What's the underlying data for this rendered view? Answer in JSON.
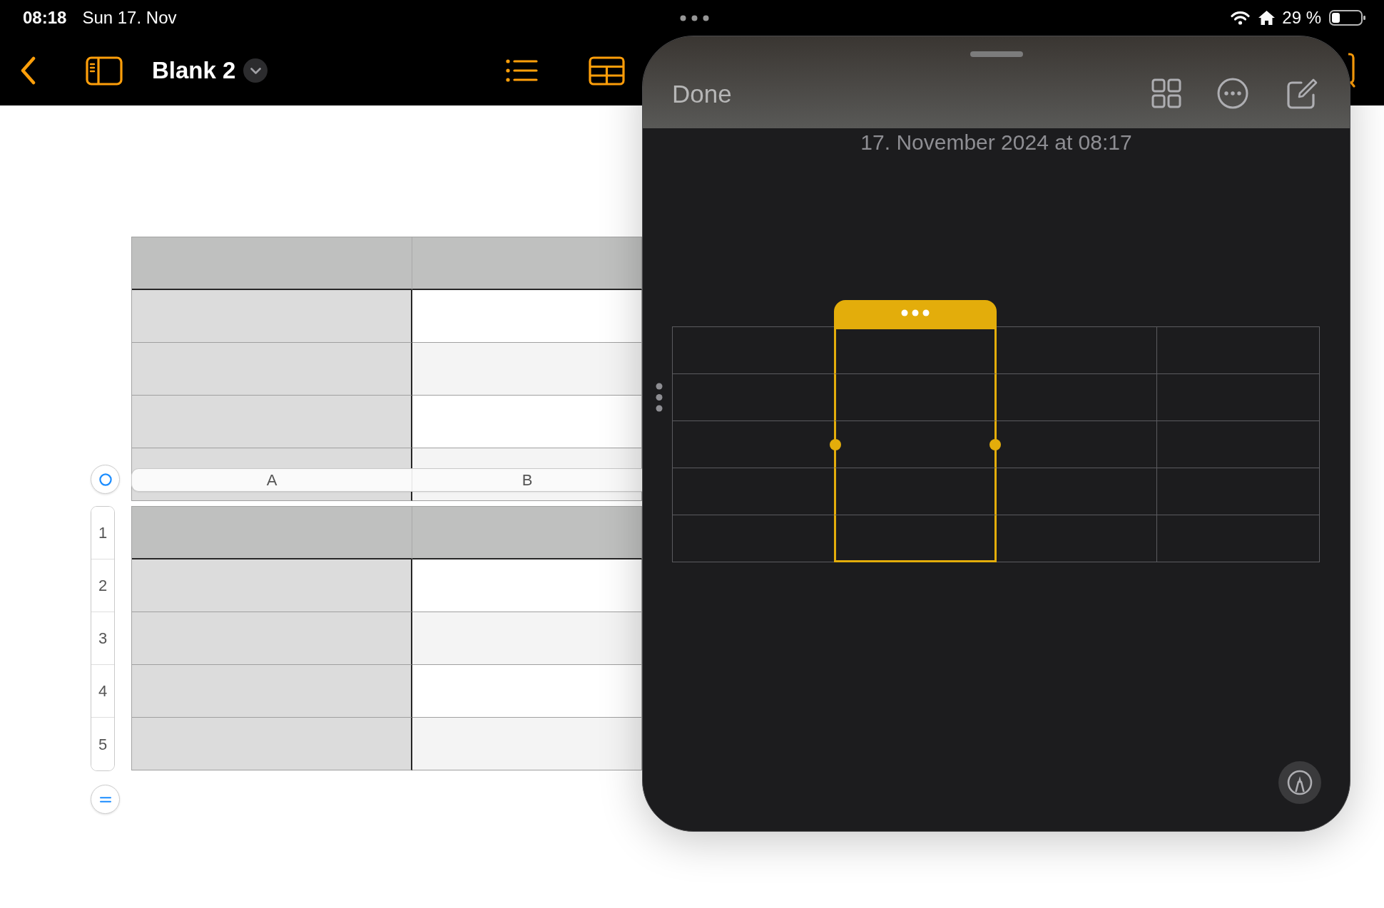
{
  "status_bar": {
    "time": "08:18",
    "date": "Sun 17. Nov",
    "battery": "29 %"
  },
  "toolbar": {
    "title": "Blank 2"
  },
  "table": {
    "column_headers": [
      "A",
      "B"
    ],
    "row_headers": [
      "1",
      "2",
      "3",
      "4",
      "5"
    ]
  },
  "quick_note": {
    "done": "Done",
    "date": "17. November 2024 at 08:17",
    "table": {
      "columns": [
        {
          "selected": false
        },
        {
          "selected": true
        },
        {
          "selected": false
        },
        {
          "selected": false
        }
      ]
    }
  }
}
